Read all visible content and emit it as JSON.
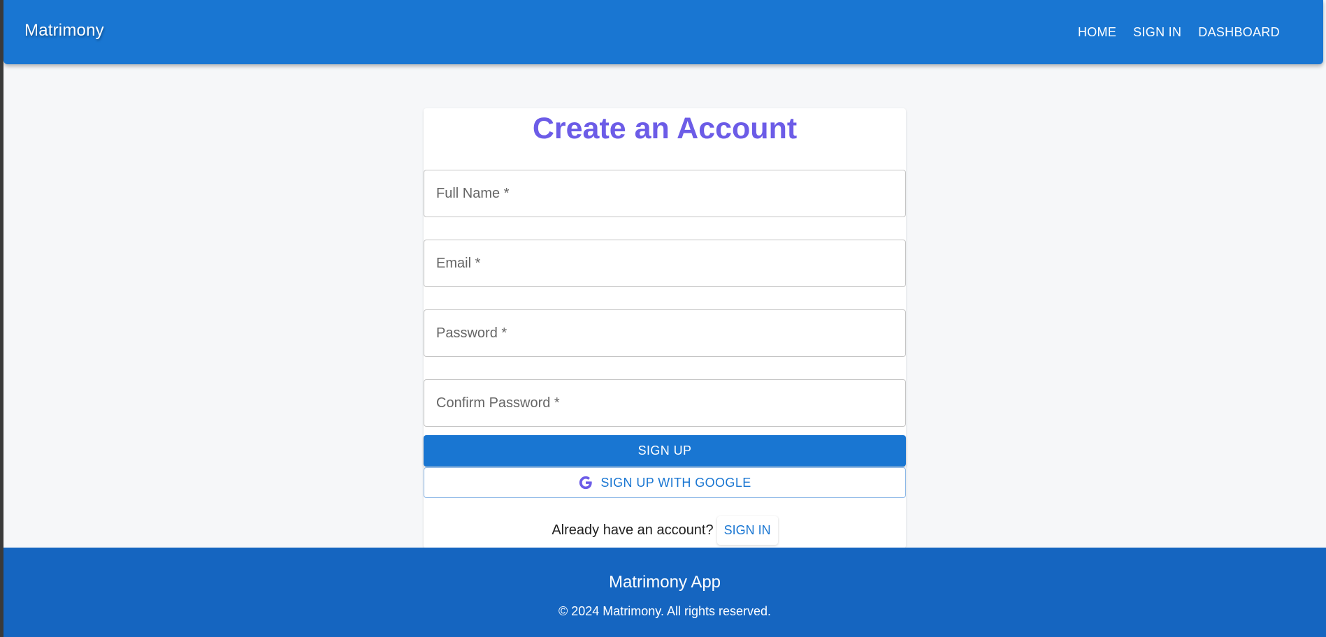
{
  "header": {
    "brand": "Matrimony",
    "nav": [
      {
        "label": "HOME"
      },
      {
        "label": "SIGN IN"
      },
      {
        "label": "DASHBOARD"
      }
    ]
  },
  "form": {
    "title": "Create an Account",
    "fields": {
      "full_name": {
        "placeholder": "Full Name *",
        "value": ""
      },
      "email": {
        "placeholder": "Email *",
        "value": ""
      },
      "password": {
        "placeholder": "Password *",
        "value": ""
      },
      "confirm_password": {
        "placeholder": "Confirm Password *",
        "value": ""
      }
    },
    "signup_label": "SIGN UP",
    "google_label": "SIGN UP WITH GOOGLE",
    "signin_prompt": "Already have an account?",
    "signin_link": "SIGN IN"
  },
  "footer": {
    "title": "Matrimony App",
    "copyright": "© 2024 Matrimony. All rights reserved."
  },
  "colors": {
    "primary": "#1976d2",
    "footer": "#1565c0",
    "title": "#6c5ce7",
    "background": "#f6f7f9"
  },
  "icons": {
    "google": "google-g-icon"
  }
}
